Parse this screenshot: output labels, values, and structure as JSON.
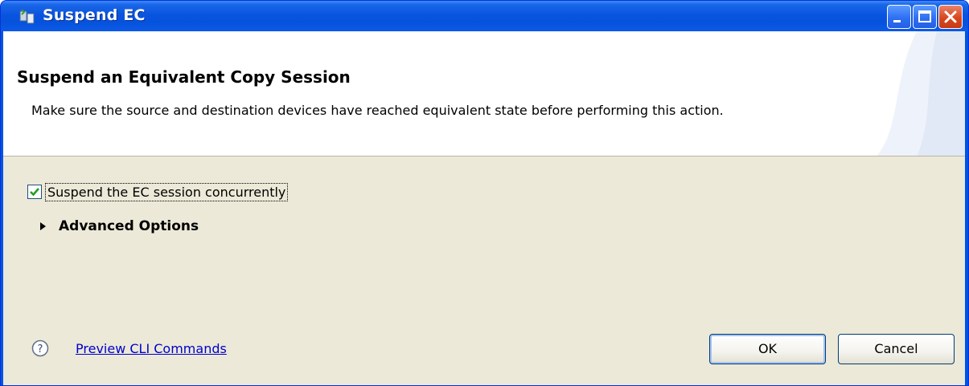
{
  "window": {
    "title": "Suspend EC",
    "title_icon": "ec-app-icon",
    "controls": [
      "minimize",
      "maximize",
      "close"
    ]
  },
  "header": {
    "title": "Suspend an Equivalent Copy Session",
    "description": "Make sure the source and destination devices have reached equivalent state before performing this action."
  },
  "options": {
    "concurrent_checkbox_label": "Suspend the EC session concurrently",
    "concurrent_checked": true,
    "advanced_label": "Advanced Options",
    "advanced_expanded": false
  },
  "footer": {
    "help_icon": "help-icon",
    "preview_link": "Preview CLI Commands",
    "ok_label": "OK",
    "cancel_label": "Cancel"
  },
  "colors": {
    "titlebar": "#0054e3",
    "dialog_bg": "#ece9d8",
    "link": "#0000cc",
    "check": "#21a121"
  }
}
